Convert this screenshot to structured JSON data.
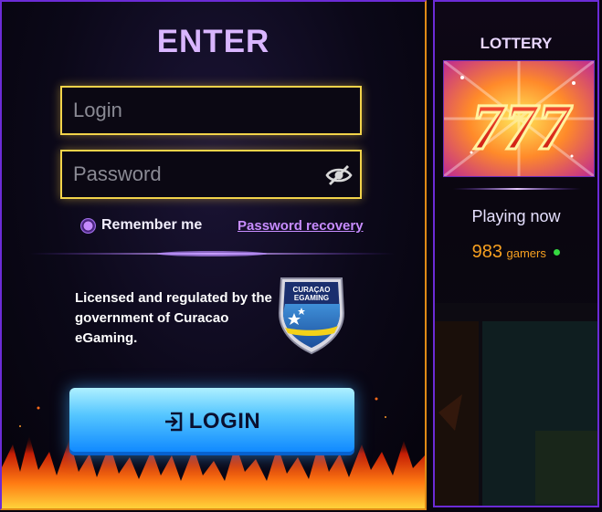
{
  "login_panel": {
    "title": "ENTER",
    "login_placeholder": "Login",
    "password_placeholder": "Password",
    "remember_label": "Remember me",
    "recovery_link": "Password recovery",
    "license_text": "Licensed and regulated by the government of Curacao eGaming.",
    "badge_text_1": "CURAÇAO",
    "badge_text_2": "EGAMING",
    "login_button": "LOGIN"
  },
  "lottery_panel": {
    "title": "LOTTERY",
    "game_label": "777",
    "playing_label": "Playing now",
    "gamers_count": "983",
    "gamers_unit": "gamers"
  },
  "colors": {
    "accent_purple": "#6b2bd6",
    "field_border": "#f2d34a",
    "button_blue": "#0a84ff",
    "count_orange": "#f7a020",
    "online_green": "#35d940"
  },
  "icons": [
    "eye-off-icon",
    "radio-icon",
    "login-arrow-icon",
    "curacao-badge-icon"
  ]
}
